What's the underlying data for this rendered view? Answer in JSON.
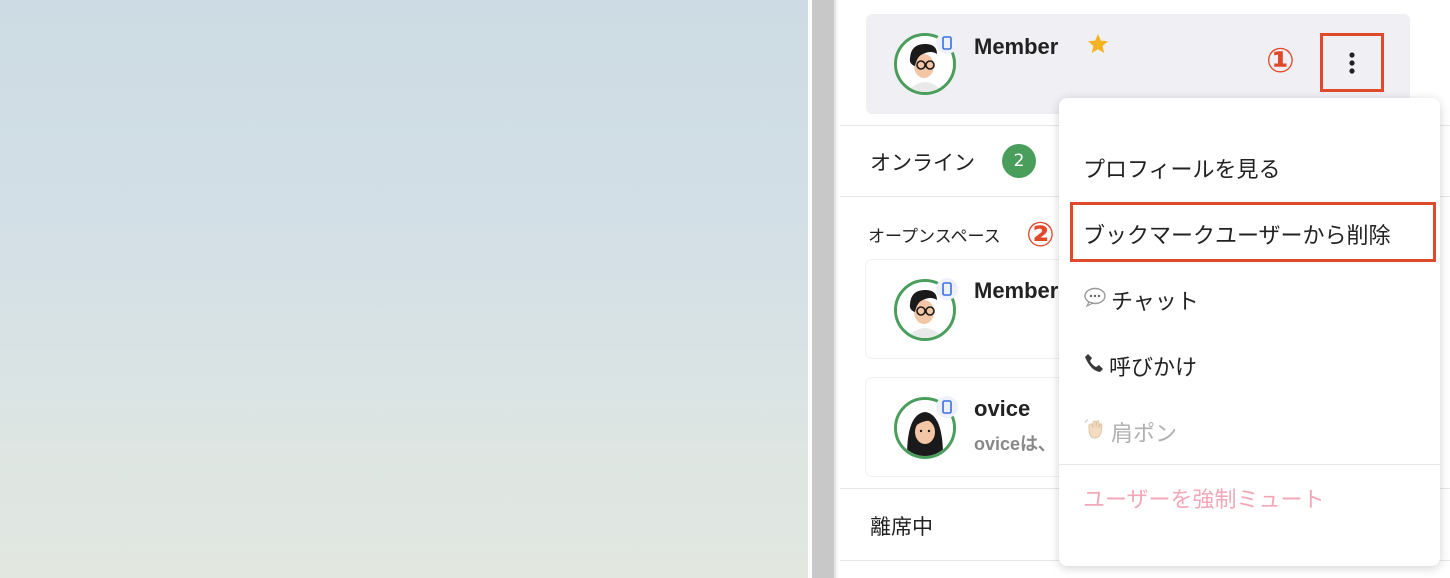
{
  "bookmarks": {
    "name": "Member",
    "star_icon": "star-icon",
    "device_icon": "mobile-device-icon"
  },
  "online": {
    "label": "オンライン",
    "count": "2"
  },
  "openspace": {
    "label": "オープンスペース",
    "users": [
      {
        "name": "Member",
        "status": ""
      },
      {
        "name": "ovice",
        "status": "oviceは、"
      }
    ]
  },
  "away": {
    "label": "離席中"
  },
  "annotations": {
    "first": "①",
    "second": "②"
  },
  "menu": {
    "view_profile": "プロフィールを見る",
    "remove_bookmark": "ブックマークユーザーから削除",
    "chat": "チャット",
    "call": "呼びかけ",
    "tap_shoulder": "肩ポン",
    "force_mute": "ユーザーを強制ミュート"
  },
  "colors": {
    "accent_green": "#4a9e5c",
    "annotation_red": "#e04a2b",
    "star_gold": "#f5b324",
    "danger_pink": "#f2a7b8"
  }
}
